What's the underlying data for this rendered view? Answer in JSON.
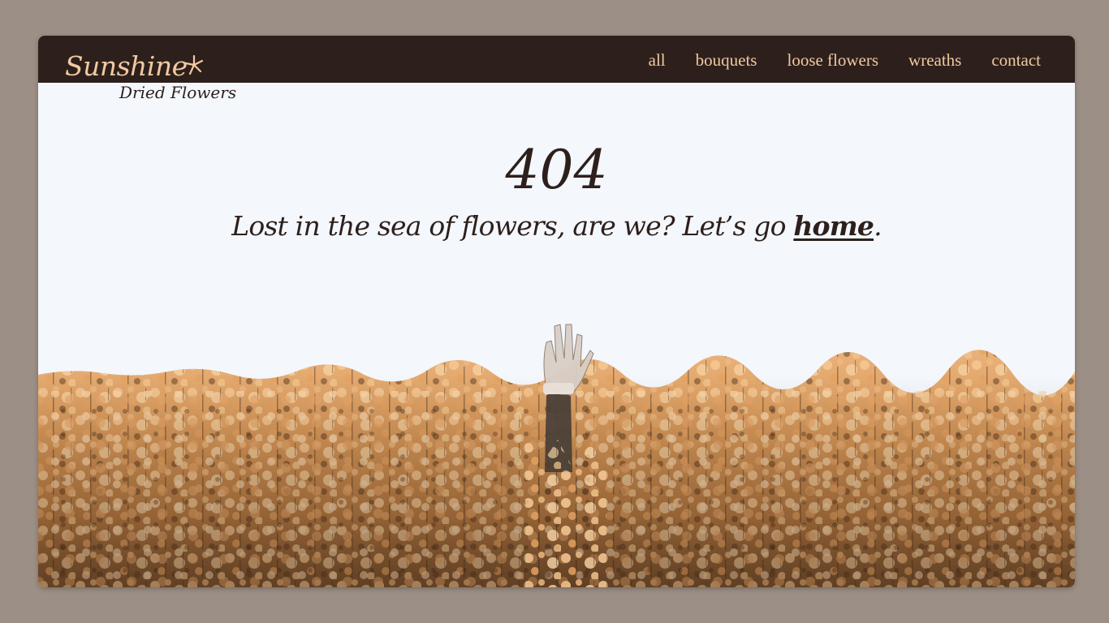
{
  "brand": {
    "name": "Sunshine",
    "tagline": "Dried Flowers",
    "icon": "flower-icon"
  },
  "nav": {
    "items": [
      {
        "label": "all"
      },
      {
        "label": "bouquets"
      },
      {
        "label": "loose flowers"
      },
      {
        "label": "wreaths"
      },
      {
        "label": "contact"
      }
    ]
  },
  "error": {
    "code": "404",
    "message_prefix": "Lost in the sea of flowers, are we? Let’s go ",
    "home_link": "home",
    "message_suffix": "."
  },
  "colors": {
    "page_bg": "#9c8f85",
    "navbar": "#2d201c",
    "accent": "#f2c9a0",
    "sky": "#f4f7fc",
    "field": "#e7ab6c"
  }
}
